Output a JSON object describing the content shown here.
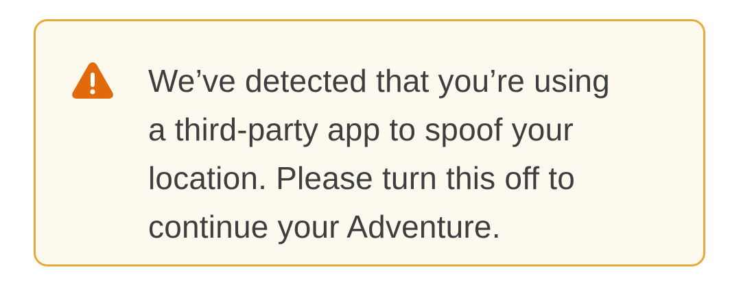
{
  "alert": {
    "icon": "warning-triangle-icon",
    "icon_color": "#e06a0c",
    "border_color": "#e8a93a",
    "background_color": "#fdf9ef",
    "lines": [
      "We’ve detected that you’re using",
      "a third-party app to spoof your",
      "location. Please turn this off to",
      "continue your Adventure."
    ]
  }
}
